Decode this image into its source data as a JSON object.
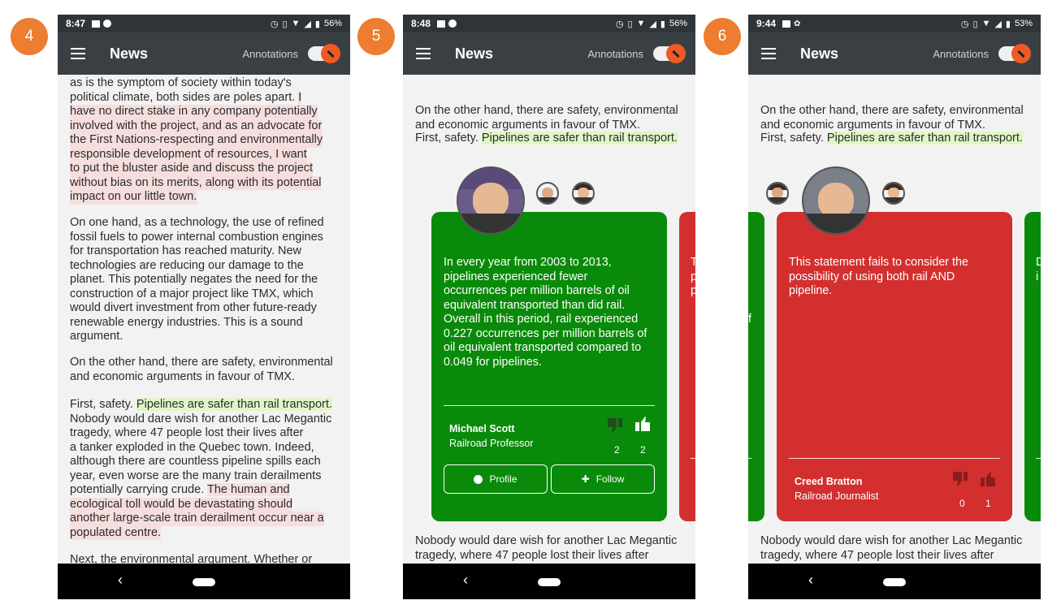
{
  "steps": [
    "4",
    "5",
    "6"
  ],
  "colors": {
    "badge": "#ED7D31",
    "card_green": "#0a8a0a",
    "card_red": "#d32f2f",
    "highlight_pink": "#f6dede",
    "highlight_green": "#e0f6c6",
    "appbar": "#3a3f44"
  },
  "screens": [
    {
      "status": {
        "time": "8:47",
        "battery": "56%"
      },
      "appbar": {
        "title": "News",
        "annotations_label": "Annotations",
        "menu_icon": "hamburger-menu-icon",
        "toggle_on": true
      },
      "paragraphs": [
        [
          "as is the symptom of society within today's",
          "political climate, both sides are poles apart. I",
          "have no direct stake in any company potentially",
          "involved with the project, and as an advocate for",
          "the First Nations-respecting and environmentally",
          "responsible development of resources, I want",
          "to put the bluster aside and discuss the project",
          "without bias on its merits, along with its potential",
          "impact on our little town."
        ],
        [
          "On one hand, as a technology, the use of refined",
          "fossil fuels to power internal combustion engines",
          "for transportation has reached maturity. New",
          "technologies are reducing our damage to the",
          "planet. This potentially negates the need for the",
          "construction of a major project like TMX, which",
          "would divert investment from other future-ready",
          "renewable energy industries. This is a sound",
          "argument."
        ],
        [
          "On the other hand, there are safety, environmental",
          "and economic arguments in favour of TMX."
        ],
        [
          "First, safety. Pipelines are safer than rail transport.",
          "Nobody would dare wish for another Lac Megantic",
          "tragedy, where 47 people lost their lives after",
          "a tanker exploded in the Quebec town. Indeed,",
          "although there are countless pipeline spills each",
          "year, even worse are the many train derailments",
          "potentially carrying crude. The human and",
          "ecological toll would be devastating should",
          "another large-scale train derailment occur near a",
          "populated centre."
        ],
        [
          "Next, the environmental argument. Whether or"
        ]
      ],
      "nav": {
        "back": "‹"
      }
    },
    {
      "status": {
        "time": "8:48",
        "battery": "56%"
      },
      "appbar": {
        "title": "News",
        "annotations_label": "Annotations",
        "toggle_on": true
      },
      "paragraphs": [
        [
          "On the other hand, there are safety, environmental",
          "and economic arguments in favour of TMX."
        ],
        [
          "First, safety. ",
          "Pipelines are safer than rail transport."
        ],
        [
          "Nobody would dare wish for another Lac Megantic",
          "tragedy, where 47 people lost their lives after"
        ]
      ],
      "card": {
        "text": [
          "In every year from 2003 to 2013,",
          "pipelines experienced fewer",
          "occurrences per million barrels of oil",
          "equivalent transported than did rail.",
          "Overall in this period, rail experienced",
          "0.227 occurrences per million barrels of",
          "oil equivalent transported compared to",
          "0.049 for pipelines."
        ],
        "author": "Michael Scott",
        "role": "Railroad Professor",
        "dislikes": "2",
        "likes": "2",
        "profile_label": "Profile",
        "follow_label": "Follow"
      },
      "next_card_text": [
        "T",
        "p",
        "p"
      ]
    },
    {
      "status": {
        "time": "9:44",
        "battery": "53%"
      },
      "appbar": {
        "title": "News",
        "annotations_label": "Annotations",
        "toggle_on": true
      },
      "paragraphs": [
        [
          "On the other hand, there are safety, environmental",
          "and economic arguments in favour of TMX."
        ],
        [
          "First, safety. ",
          "Pipelines are safer than rail transport."
        ],
        [
          "Nobody would dare wish for another Lac Megantic",
          "tragedy, where 47 people lost their lives after"
        ]
      ],
      "card": {
        "text": [
          "This statement fails to consider the",
          "possibility of using both rail AND",
          "pipeline."
        ],
        "author": "Creed Bratton",
        "role": "Railroad Journalist",
        "dislikes": "0",
        "likes": "1"
      },
      "prev_card_text": [
        "f"
      ],
      "next_card_text": [
        "D",
        "i"
      ]
    }
  ]
}
